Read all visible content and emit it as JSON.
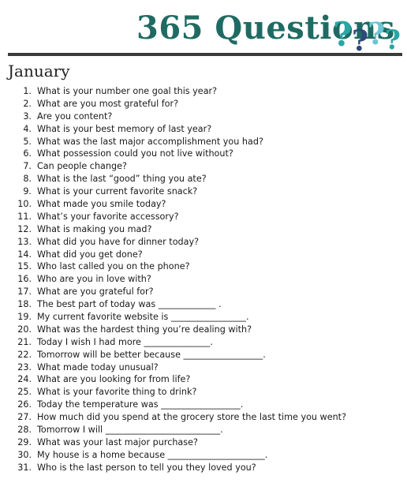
{
  "header": {
    "title": "365 Questions",
    "logo_icon": "question-marks-icon",
    "colors": {
      "title": "#1f6b63",
      "qmark_teal": "#2aa6a6",
      "qmark_dark": "#2d4a7a",
      "qmark_light": "#6cc6d4"
    }
  },
  "month": "January",
  "questions": [
    {
      "num": "1.",
      "text": "What is your number one goal this year?"
    },
    {
      "num": "2.",
      "text": "What are you most grateful for?"
    },
    {
      "num": "3.",
      "text": "Are you content?"
    },
    {
      "num": "4.",
      "text": "What is your best memory of last year?"
    },
    {
      "num": "5.",
      "text": "What was the last major accomplishment you had?"
    },
    {
      "num": "6.",
      "text": "What possession could you not live without?"
    },
    {
      "num": "7.",
      "text": "Can people change?"
    },
    {
      "num": "8.",
      "text": "What is the last “good” thing you ate?"
    },
    {
      "num": "9.",
      "text": "What is your current favorite snack?"
    },
    {
      "num": "10.",
      "text": "What made you smile today?"
    },
    {
      "num": "11.",
      "text": "What’s your favorite accessory?"
    },
    {
      "num": "12.",
      "text": "What is making you mad?"
    },
    {
      "num": "13.",
      "text": "What did you have for dinner today?"
    },
    {
      "num": "14.",
      "text": "What did you get done?"
    },
    {
      "num": "15.",
      "text": "Who last called you on the phone?"
    },
    {
      "num": "16.",
      "text": "Who are you in love with?"
    },
    {
      "num": "17.",
      "text": "What are you grateful for?"
    },
    {
      "num": "18.",
      "text": "The best part of today was _____________ ."
    },
    {
      "num": "19.",
      "text": "My current favorite website is _________________."
    },
    {
      "num": "20.",
      "text": "What was the hardest thing you’re dealing with?"
    },
    {
      "num": "21.",
      "text": "Today I wish I had more _______________."
    },
    {
      "num": "22.",
      "text": "Tomorrow will be better because __________________."
    },
    {
      "num": "23.",
      "text": "What made today unusual?"
    },
    {
      "num": "24.",
      "text": "What are you looking for from life?"
    },
    {
      "num": "25.",
      "text": "What is your favorite thing to drink?"
    },
    {
      "num": "26.",
      "text": "Today the temperature was __________________."
    },
    {
      "num": "27.",
      "text": "How much did you spend at the grocery store the last time you went?"
    },
    {
      "num": "28.",
      "text": "Tomorrow I will __________________________."
    },
    {
      "num": "29.",
      "text": "What was your last major purchase?"
    },
    {
      "num": "30.",
      "text": "My house is a home because ______________________."
    },
    {
      "num": "31.",
      "text": "Who is the last person to tell you they loved you?"
    }
  ]
}
